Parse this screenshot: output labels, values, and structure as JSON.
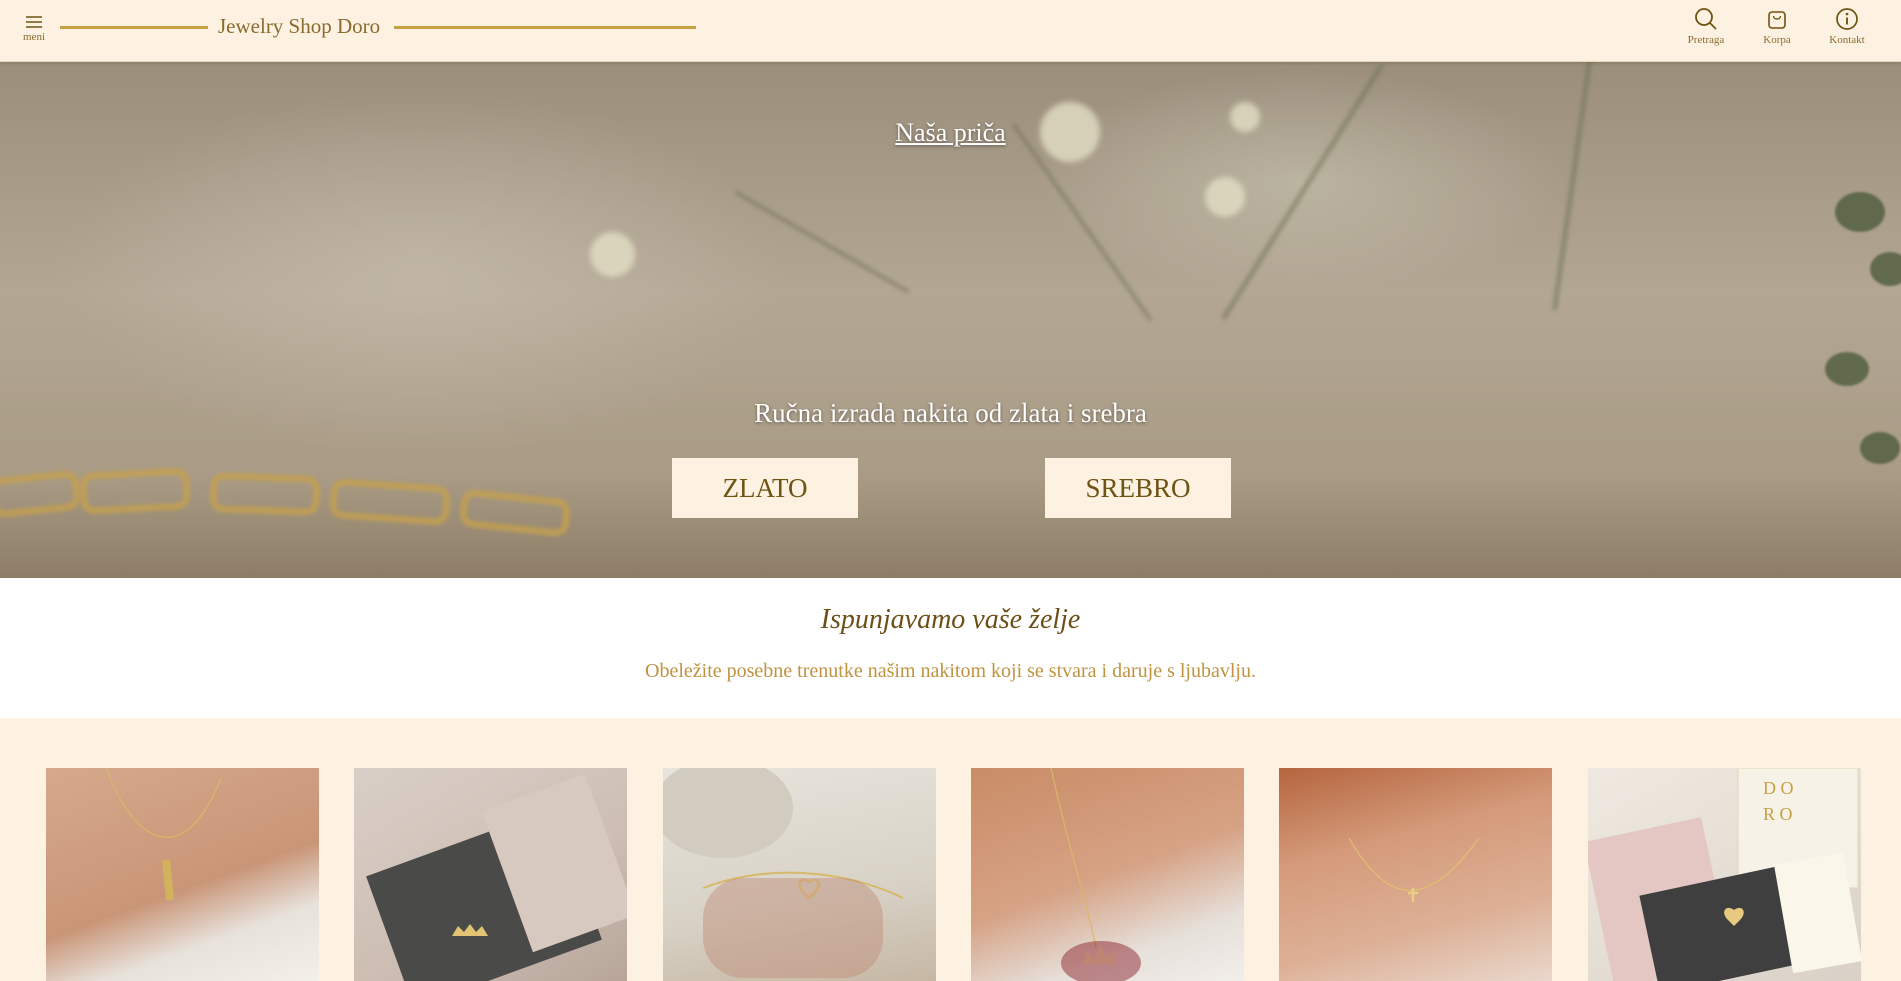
{
  "header": {
    "menu_label": "meni",
    "brand_name": "Jewelry Shop Doro",
    "search_label": "Pretraga",
    "cart_label": "Korpa",
    "contact_label": "Kontakt"
  },
  "hero": {
    "story_link": "Naša priča",
    "tagline": "Ručna izrada nakita od zlata i srebra",
    "gold_button": "ZLATO",
    "silver_button": "SREBRO"
  },
  "intro": {
    "title": "Ispunjavamo vaše želje",
    "subtitle": "Obeležite posebne trenutke našim nakitom koji se stvara i daruje s ljubavlju."
  },
  "products": [
    {
      "id": "p1"
    },
    {
      "id": "p2"
    },
    {
      "id": "p3"
    },
    {
      "id": "p4"
    },
    {
      "id": "p5"
    },
    {
      "id": "p6"
    }
  ],
  "colors": {
    "background": "#fdf2e1",
    "accent_gold": "#c5a142",
    "text_brown": "#6c4f17",
    "subtitle_gold": "#bf9340"
  }
}
